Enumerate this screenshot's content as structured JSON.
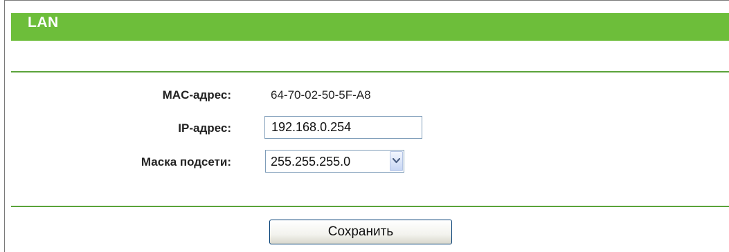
{
  "section": {
    "title": "LAN"
  },
  "form": {
    "mac_label": "MAC-адрес:",
    "mac_value": "64-70-02-50-5F-A8",
    "ip_label": "IP-адрес:",
    "ip_value": "192.168.0.254",
    "mask_label": "Маска подсети:",
    "mask_selected": "255.255.255.0"
  },
  "actions": {
    "save_label": "Сохранить"
  },
  "colors": {
    "title_bar": "#6dbe3a",
    "divider": "#5aa33a"
  },
  "icons": {
    "dropdown": "chevron-down-icon"
  }
}
